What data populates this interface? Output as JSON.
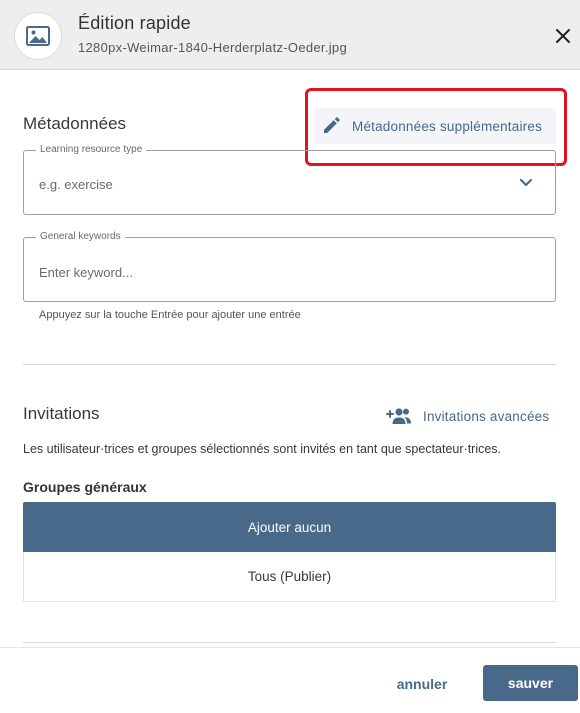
{
  "header": {
    "title": "Édition rapide",
    "filename": "1280px-Weimar-1840-Herderplatz-Oeder.jpg",
    "icon": "image-icon",
    "close_icon": "close-icon"
  },
  "metadata": {
    "title": "Métadonnées",
    "more_link_label": "Métadonnées supplémentaires",
    "more_link_icon": "pencil-icon",
    "resource_type": {
      "label": "Learning resource type",
      "value": "e.g. exercise"
    },
    "keywords": {
      "label": "General keywords",
      "placeholder": "Enter keyword...",
      "hint": "Appuyez sur la touche Entrée pour ajouter une entrée"
    }
  },
  "invitations": {
    "title": "Invitations",
    "advanced_link_label": "Invitations avancées",
    "advanced_link_icon": "add-people-icon",
    "description": "Les utilisateur·trices et groupes sélectionnés sont invités en tant que spectateur·trices.",
    "groups_label": "Groupes généraux",
    "options": [
      {
        "label": "Ajouter aucun",
        "selected": true
      },
      {
        "label": "Tous (Publier)",
        "selected": false
      }
    ]
  },
  "footer": {
    "cancel_label": "annuler",
    "save_label": "sauver"
  },
  "colors": {
    "accent": "#48698a",
    "highlight_box": "#e0141e",
    "header_bg": "#eeeeee"
  }
}
